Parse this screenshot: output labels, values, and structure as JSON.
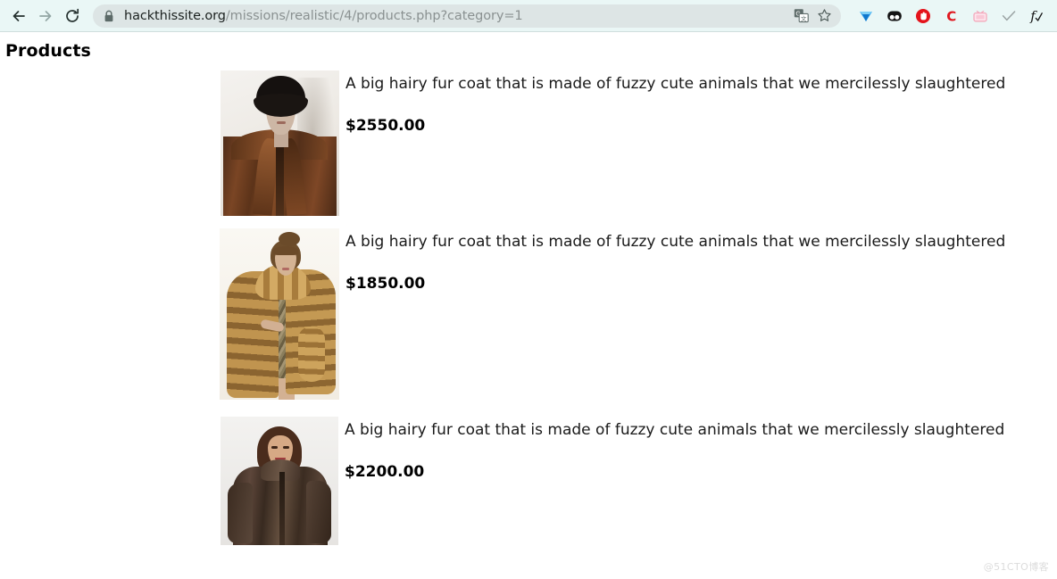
{
  "browser": {
    "back_label": "Back",
    "forward_label": "Forward",
    "reload_label": "Reload this page",
    "security_icon": "lock-icon",
    "url_domain": "hackthissite.org",
    "url_path": "/missions/realistic/4/products.php?category=1",
    "url_full": "hackthissite.org/missions/realistic/4/products.php?category=1",
    "omnibox_actions": [
      {
        "name": "translate-icon",
        "label": "Translate this page"
      },
      {
        "name": "bookmark-star-icon",
        "label": "Bookmark this tab"
      }
    ],
    "extensions": [
      {
        "name": "diamond-extension-icon",
        "label": "Diamond extension",
        "color": "#1f8fe8"
      },
      {
        "name": "panda-extension-icon",
        "label": "Panda extension",
        "color": "#111111"
      },
      {
        "name": "opera-vpn-extension-icon",
        "label": "Opera-style extension",
        "color": "#e5131b"
      },
      {
        "name": "letter-c-extension-icon",
        "label": "C extension",
        "color": "#e0171f"
      },
      {
        "name": "pink-tv-extension-icon",
        "label": "Pink TV extension",
        "color": "#f6b9c6"
      },
      {
        "name": "checkmark-extension-icon",
        "label": "Checkmark extension",
        "color": "#9aa3a3"
      },
      {
        "name": "formula-extension-icon",
        "label": "Formula extension",
        "color": "#1a1a1a"
      }
    ]
  },
  "page": {
    "title": "Products",
    "watermark": "@51CTO博客",
    "products": [
      {
        "image_name": "fur-coat-mannequin-photo",
        "image_alt": "Mannequin in black hat wearing a brown fur coat",
        "description": "A big hairy fur coat that is made of fuzzy cute animals that we mercilessly slaughtered",
        "price": "$2550.00"
      },
      {
        "image_name": "fur-coat-model-gold-photo",
        "image_alt": "Model wearing a long golden-tan fur coat over a patterned dress",
        "description": "A big hairy fur coat that is made of fuzzy cute animals that we mercilessly slaughtered",
        "price": "$1850.00"
      },
      {
        "image_name": "fur-jacket-woman-photo",
        "image_alt": "Smiling woman wearing a dark brown fur jacket",
        "description": "A big hairy fur coat that is made of fuzzy cute animals that we mercilessly slaughtered",
        "price": "$2200.00"
      }
    ]
  },
  "colors": {
    "toolbar_bg": "#eaf7f6",
    "omnibox_bg": "#dde5e5",
    "url_domain_text": "#1c2220",
    "url_path_text": "#8a9191",
    "page_bg": "#ffffff",
    "text": "#1a1a1a"
  }
}
